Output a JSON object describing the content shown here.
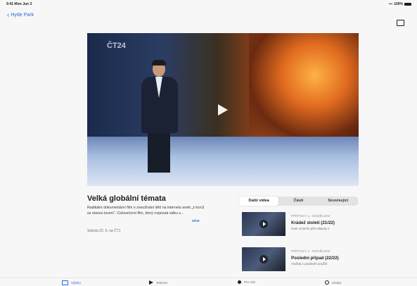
{
  "status": {
    "time": "9:41",
    "date": "Mon Jun 3",
    "battery": "100%"
  },
  "nav": {
    "back_label": "Hyde Park"
  },
  "hero": {
    "channel_logo": "ČT24"
  },
  "show": {
    "title": "Velká globální témata",
    "description": "Radikální dokumentární film o zneužívání dětí na internetu aneb „z lovců se stanou lovení“. Celovečerní film, který rozpoutá válku s...",
    "more_label": "více",
    "airdate": "Sobota 22. 5. na ČT1"
  },
  "segments": [
    {
      "label": "Další videa",
      "active": true
    },
    {
      "label": "Části",
      "active": false
    },
    {
      "label": "Související",
      "active": false
    }
  ],
  "episodes": [
    {
      "category": "PŘÍPADY 1. ODDĚLENÍ",
      "title": "Krádež století (21/22)",
      "subtitle": "Kam zmizelo půl miliardy z"
    },
    {
      "category": "PŘÍPADY 1. ODDĚLENÍ",
      "title": "Poslední případ (22/22)",
      "subtitle": "Vražda v poslední použití"
    }
  ],
  "tabs": [
    {
      "label": "Výběry",
      "icon": "grid-icon",
      "active": true
    },
    {
      "label": "Televize",
      "icon": "play-icon",
      "active": false
    },
    {
      "label": "Pro Vás",
      "icon": "user-icon",
      "active": false
    },
    {
      "label": "Hledat",
      "icon": "search-icon",
      "active": false
    }
  ],
  "colors": {
    "accent": "#2a6bd6",
    "background": "#f7f7f8"
  }
}
